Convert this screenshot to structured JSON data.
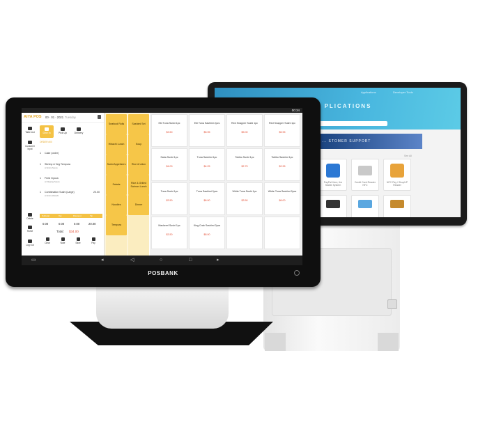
{
  "rear_display": {
    "nav_tabs": [
      "Applications",
      "Developer Tools"
    ],
    "banner_text": "... SSIVE ... PLICATIONS",
    "promo_text": "... STOMER SUPPORT",
    "see_all": "See All",
    "tiles": [
      {
        "label": "PayPal Here, the Stable System",
        "color": "#2b78d4"
      },
      {
        "label": "Credit Card Reader NFC",
        "color": "#c9c9c9"
      },
      {
        "label": "NFC Pay / ShopUP Reader",
        "color": "#e8a33a"
      }
    ],
    "accent_color": "#49b7df"
  },
  "device": {
    "brand": "POSBANK",
    "status_time": "00:34"
  },
  "app": {
    "logo": "AIYA POS",
    "date": "00 · 01 · 2021",
    "weekday": "Tuesday",
    "side_buttons": [
      "Table List",
      "Customer Input",
      "Delete",
      "Home",
      "Log Out"
    ],
    "order_tabs": [
      "Dine In",
      "Pick Up",
      "Delivery"
    ],
    "order_meta": "ORDER #00",
    "line_items": [
      {
        "qty": "1",
        "name": "Cake (order)",
        "sub": "",
        "price": ""
      },
      {
        "qty": "1",
        "name": "Shrimp & Veg Tempura",
        "sub": "w/ Extra Sauce",
        "price": ""
      },
      {
        "qty": "1",
        "name": "Fried Gyoza",
        "sub": "w/ Dipping Sauce",
        "price": ""
      },
      {
        "qty": "1",
        "name": "Combination Sushi (Large)",
        "sub": "w/ Extra Wasabi",
        "price": "20.00"
      }
    ],
    "totals_headers": [
      "Subtotal",
      "Tax",
      "Discount",
      "Tip"
    ],
    "totals_values": [
      "0.00",
      "0.00",
      "0.00",
      "20.00"
    ],
    "total_label": "Total:",
    "total_value": "$34.00",
    "footer_buttons": [
      "Clear",
      "Note",
      "Save",
      "Pay"
    ],
    "accent_color": "#f4c244",
    "price_color": "#e24a2f"
  },
  "categories": [
    [
      "Seafood Rolls",
      "Sashimi Set"
    ],
    [
      "Hibachi Lunch",
      "Soup"
    ],
    [
      "Sushi Appetizers",
      "Rice & Udon"
    ],
    [
      "Salads",
      "Rice & Grilled Salmon Lunch"
    ],
    [
      "Noodles",
      "Dinner"
    ],
    [
      "Tempura",
      ""
    ],
    [
      "",
      ""
    ]
  ],
  "menu_items": [
    [
      {
        "name": "Ebi Tuna Sushi 1pc",
        "price": "$3.50"
      },
      {
        "name": "Ebi Tuna Sashimi 2pcs",
        "price": "$5.95"
      },
      {
        "name": "Red Snapper Sushi 1pc",
        "price": "$5.00"
      },
      {
        "name": "Red Snapper Sushi 1pc",
        "price": "$5.95"
      }
    ],
    [
      {
        "name": "Saba Sushi 1pc",
        "price": "$4.00"
      },
      {
        "name": "Tuna Sashimi 1pc",
        "price": "$4.25"
      },
      {
        "name": "Tobiko Sushi 1pc",
        "price": "$2.75"
      },
      {
        "name": "Tobiko Sashimi 1pc",
        "price": "$2.95"
      }
    ],
    [
      {
        "name": "Tuna Sushi 1pc",
        "price": "$3.50"
      },
      {
        "name": "Tuna Sashimi 2pcs",
        "price": "$6.00"
      },
      {
        "name": "White Tuna Sushi 1pc",
        "price": "$3.50"
      },
      {
        "name": "White Tuna Sashimi 2pcs",
        "price": "$6.00"
      }
    ],
    [
      {
        "name": "Mackerel Sushi 1pc",
        "price": "$3.50"
      },
      {
        "name": "King Crab Sashimi 2pcs",
        "price": "$8.00"
      },
      {
        "name": "",
        "price": ""
      },
      {
        "name": "",
        "price": ""
      }
    ]
  ]
}
